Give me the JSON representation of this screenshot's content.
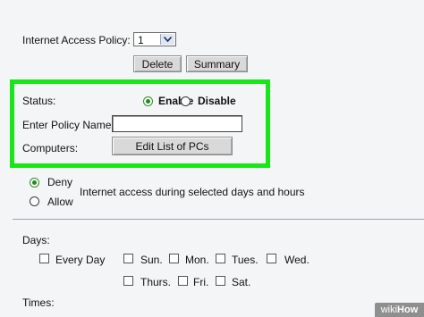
{
  "policy": {
    "label": "Internet Access Policy:",
    "selected": "1",
    "delete_label": "Delete",
    "summary_label": "Summary"
  },
  "status": {
    "label": "Status:",
    "enable_label": "Enable",
    "disable_label": "Disable",
    "enable_checked": true
  },
  "policy_name": {
    "label": "Enter Policy Name:",
    "value": ""
  },
  "computers": {
    "label": "Computers:",
    "button_label": "Edit List of PCs"
  },
  "access": {
    "deny_label": "Deny",
    "allow_label": "Allow",
    "description": "Internet access during selected days and hours"
  },
  "days": {
    "label": "Days:",
    "row1": [
      "Every Day",
      "Sun.",
      "Mon.",
      "Tues.",
      "Wed."
    ],
    "row2": [
      "Thurs.",
      "Fri.",
      "Sat."
    ]
  },
  "times": {
    "label": "Times:"
  },
  "watermark": {
    "prefix": "wiki",
    "suffix": "How"
  },
  "colors": {
    "highlight": "#19e619",
    "radio_selected": "#1e8f1e"
  },
  "icons": [
    "chevron-down-icon"
  ]
}
